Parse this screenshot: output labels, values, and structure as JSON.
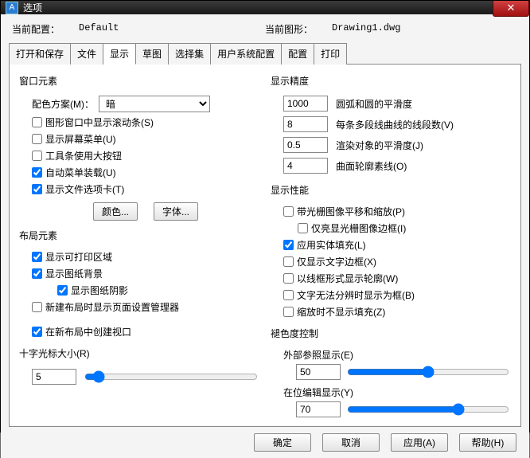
{
  "window": {
    "title": "选项"
  },
  "config": {
    "current_config_label": "当前配置：",
    "current_config_value": "Default",
    "current_drawing_label": "当前图形：",
    "current_drawing_value": "Drawing1.dwg"
  },
  "tabs": [
    {
      "label": "打开和保存"
    },
    {
      "label": "文件"
    },
    {
      "label": "显示"
    },
    {
      "label": "草图"
    },
    {
      "label": "选择集"
    },
    {
      "label": "用户系统配置"
    },
    {
      "label": "配置"
    },
    {
      "label": "打印"
    }
  ],
  "left": {
    "window_elements": "窗口元素",
    "color_scheme_label": "配色方案(M)：",
    "color_scheme_value": "暗",
    "scrollbar": "图形窗口中显示滚动条(S)",
    "screen_menu": "显示屏幕菜单(U)",
    "big_buttons": "工具条使用大按钮",
    "auto_menu": "自动菜单装载(U)",
    "show_tabs": "显示文件选项卡(T)",
    "color_btn": "颜色...",
    "font_btn": "字体...",
    "layout_elements": "布局元素",
    "print_area": "显示可打印区域",
    "paper_bg": "显示图纸背景",
    "paper_shadow": "显示图纸阴影",
    "new_layout_mgr": "新建布局时显示页面设置管理器",
    "new_layout_vp": "在新布局中创建视口",
    "crosshair_label": "十字光标大小(R)",
    "crosshair_value": "5"
  },
  "right": {
    "precision_label": "显示精度",
    "arc_value": "1000",
    "arc_label": "圆弧和圆的平滑度",
    "seg_value": "8",
    "seg_label": "每条多段线曲线的线段数(V)",
    "render_value": "0.5",
    "render_label": "渲染对象的平滑度(J)",
    "surf_value": "4",
    "surf_label": "曲面轮廓素线(O)",
    "perf_label": "显示性能",
    "raster_pan": "带光栅图像平移和缩放(P)",
    "raster_frame": "仅亮显光栅图像边框(I)",
    "solid_fill": "应用实体填充(L)",
    "text_frame": "仅显示文字边框(X)",
    "wire_sil": "以线框形式显示轮廓(W)",
    "text_illegible": "文字无法分辨时显示为框(B)",
    "zoom_nofill": "缩放时不显示填充(Z)",
    "fade_label": "褪色度控制",
    "xref_label": "外部参照显示(E)",
    "xref_value": "50",
    "inplace_label": "在位编辑显示(Y)",
    "inplace_value": "70"
  },
  "buttons": {
    "ok": "确定",
    "cancel": "取消",
    "apply": "应用(A)",
    "help": "帮助(H)"
  }
}
